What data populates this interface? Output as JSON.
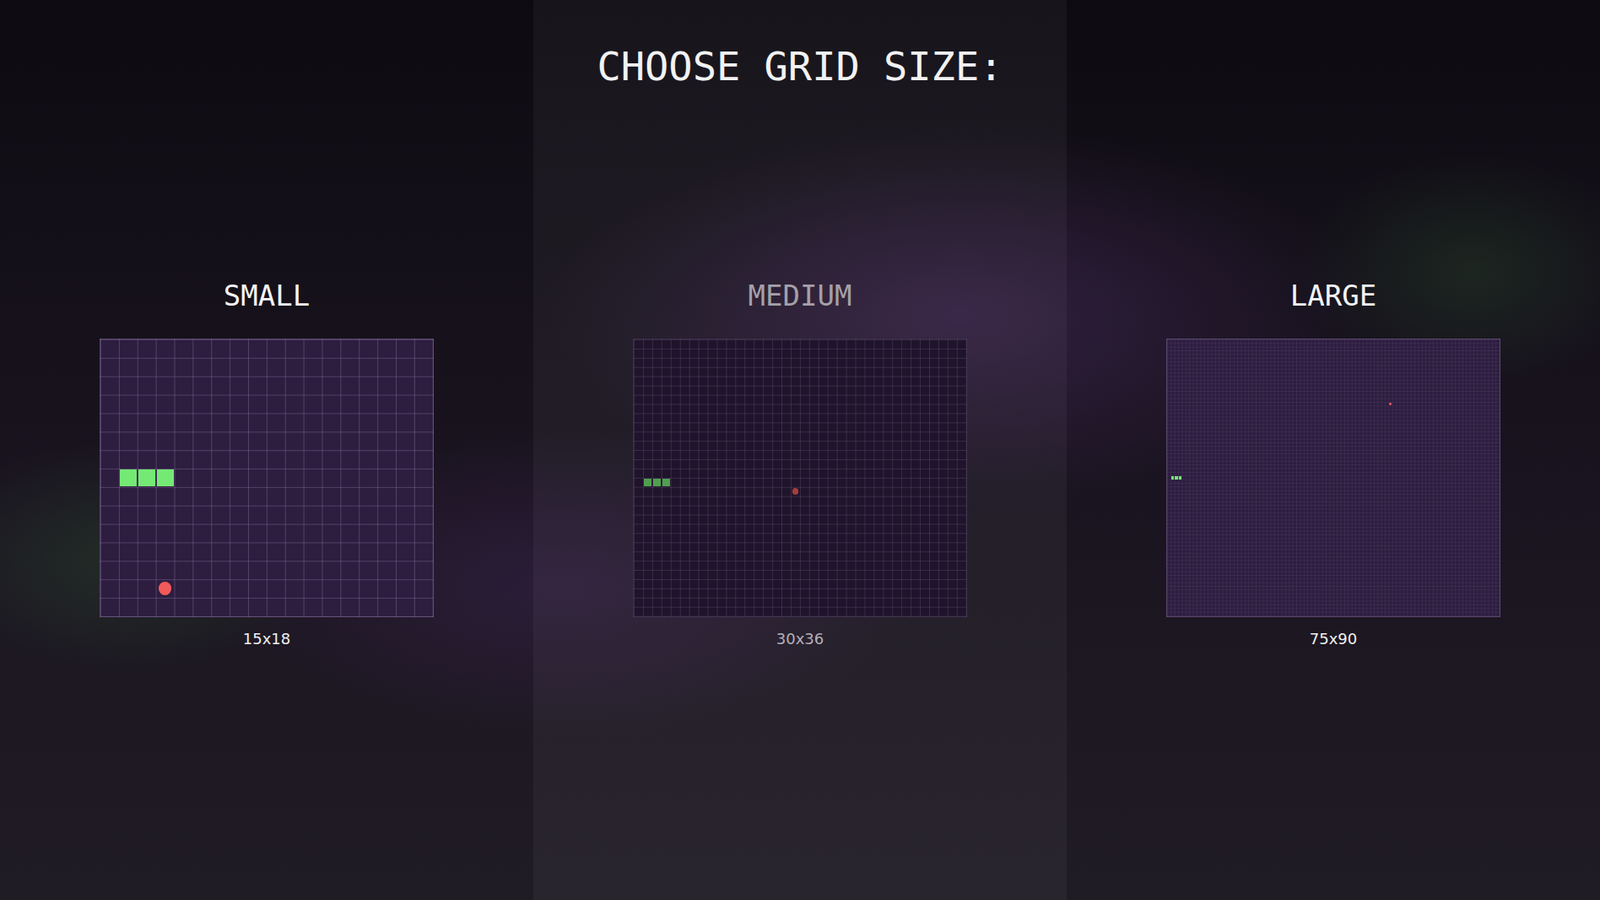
{
  "title": "CHOOSE GRID SIZE:",
  "options": [
    {
      "label": "SMALL",
      "size": "15x18",
      "rows": 15,
      "cols": 18,
      "selected": false,
      "snake": [
        [
          7,
          1
        ],
        [
          7,
          2
        ],
        [
          7,
          3
        ]
      ],
      "food": [
        13,
        3
      ]
    },
    {
      "label": "MEDIUM",
      "size": "30x36",
      "rows": 30,
      "cols": 36,
      "selected": true,
      "snake": [
        [
          15,
          1
        ],
        [
          15,
          2
        ],
        [
          15,
          3
        ]
      ],
      "food": [
        16,
        17
      ]
    },
    {
      "label": "LARGE",
      "size": "75x90",
      "rows": 75,
      "cols": 90,
      "selected": false,
      "snake": [
        [
          37,
          1
        ],
        [
          37,
          2
        ],
        [
          37,
          3
        ]
      ],
      "food": [
        17,
        60
      ]
    }
  ]
}
